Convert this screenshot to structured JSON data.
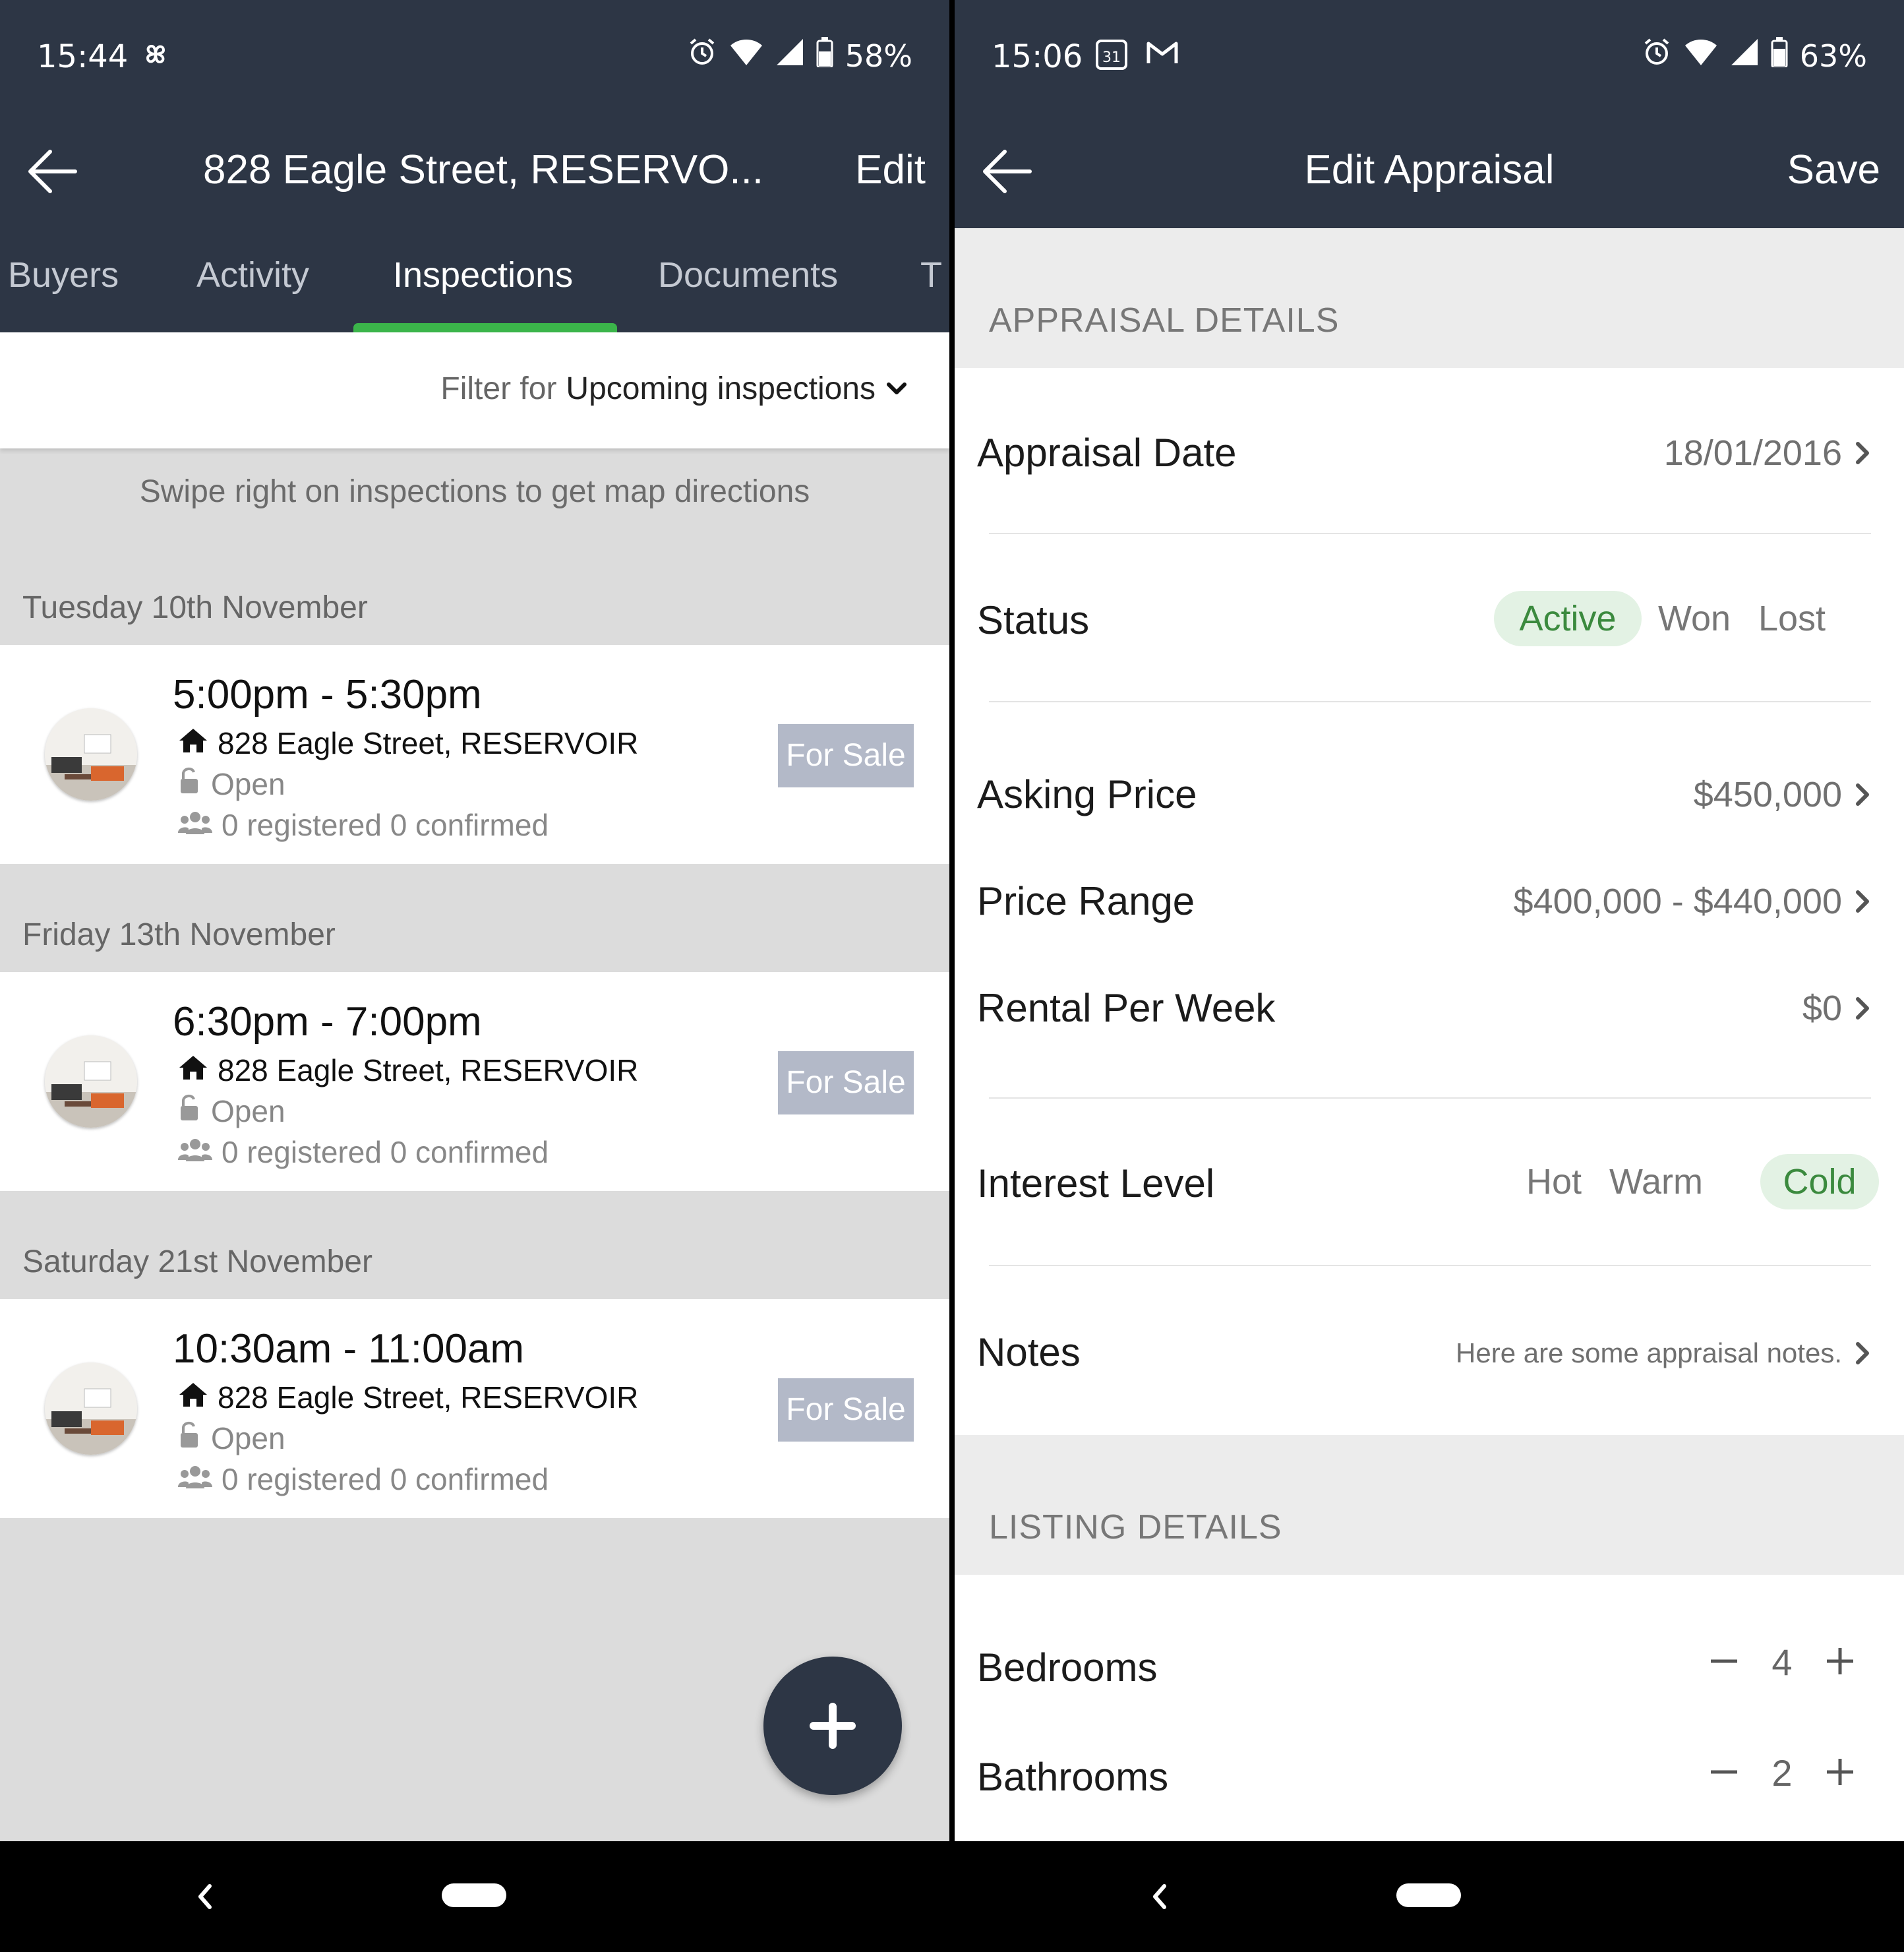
{
  "left": {
    "status_bar": {
      "time": "15:44",
      "battery": "58%"
    },
    "app_bar": {
      "title": "828 Eagle Street, RESERVO...",
      "action": "Edit"
    },
    "tabs": [
      {
        "label": "Buyers"
      },
      {
        "label": "Activity"
      },
      {
        "label": "Inspections"
      },
      {
        "label": "Documents"
      },
      {
        "label": "T"
      }
    ],
    "filter": {
      "prefix": "Filter for",
      "value": "Upcoming inspections"
    },
    "hint": "Swipe right on inspections to get map directions",
    "groups": [
      {
        "date": "Tuesday 10th November",
        "time": "5:00pm - 5:30pm",
        "address": "828 Eagle Street, RESERVOIR",
        "type": "Open",
        "registrations": "0 registered 0 confirmed",
        "badge": "For Sale"
      },
      {
        "date": "Friday 13th November",
        "time": "6:30pm - 7:00pm",
        "address": "828 Eagle Street, RESERVOIR",
        "type": "Open",
        "registrations": "0 registered 0 confirmed",
        "badge": "For Sale"
      },
      {
        "date": "Saturday 21st November",
        "time": "10:30am - 11:00am",
        "address": "828 Eagle Street, RESERVOIR",
        "type": "Open",
        "registrations": "0 registered 0 confirmed",
        "badge": "For Sale"
      }
    ]
  },
  "right": {
    "status_bar": {
      "time": "15:06",
      "calendar_day": "31",
      "battery": "63%"
    },
    "app_bar": {
      "title": "Edit Appraisal",
      "action": "Save"
    },
    "appraisal_section": "APPRAISAL DETAILS",
    "appraisal_date": {
      "label": "Appraisal Date",
      "value": "18/01/2016"
    },
    "status": {
      "label": "Status",
      "options": [
        "Active",
        "Won",
        "Lost"
      ],
      "selected": "Active"
    },
    "asking_price": {
      "label": "Asking Price",
      "value": "$450,000"
    },
    "price_range": {
      "label": "Price Range",
      "value": "$400,000 - $440,000"
    },
    "rental": {
      "label": "Rental Per Week",
      "value": "$0"
    },
    "interest": {
      "label": "Interest Level",
      "options": [
        "Hot",
        "Warm",
        "Cold"
      ],
      "selected": "Cold"
    },
    "notes": {
      "label": "Notes",
      "value": "Here are some appraisal notes."
    },
    "listing_section": "LISTING DETAILS",
    "bedrooms": {
      "label": "Bedrooms",
      "value": "4"
    },
    "bathrooms": {
      "label": "Bathrooms",
      "value": "2"
    }
  },
  "colors": {
    "header": "#2d3645",
    "tab_indicator": "#3bb54a",
    "badge": "#b3b9c8",
    "selected_chip_bg": "#e3f2e4",
    "selected_chip_text": "#3b8a3e"
  }
}
